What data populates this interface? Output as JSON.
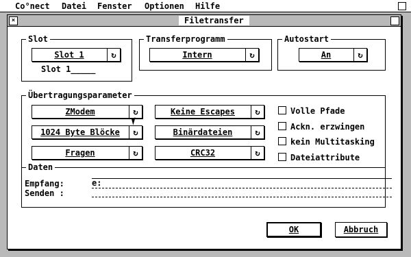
{
  "menubar": {
    "items": [
      "Co°nect",
      "Datei",
      "Fenster",
      "Optionen",
      "Hilfe"
    ]
  },
  "window": {
    "title": "Filetransfer",
    "close_glyph": "×"
  },
  "slot": {
    "legend": "Slot",
    "popup_value": "Slot 1",
    "info": "Slot 1_____"
  },
  "transfer": {
    "legend": "Transferprogramm",
    "popup_value": "Intern"
  },
  "autostart": {
    "legend": "Autostart",
    "popup_value": "An"
  },
  "params": {
    "legend": "Übertragungsparameter",
    "col1": [
      "ZModem",
      "1024 Byte Blöcke",
      "Fragen"
    ],
    "col2": [
      "Keine Escapes",
      "Binärdateien",
      "CRC32"
    ],
    "checkboxes": [
      {
        "label": "Volle Pfade",
        "checked": false
      },
      {
        "label": "Ackn. erzwingen",
        "checked": false
      },
      {
        "label": "kein Multitasking",
        "checked": false
      },
      {
        "label": "Dateiattribute",
        "checked": false
      }
    ]
  },
  "daten": {
    "legend": "Daten",
    "empfang_label": "Empfang:",
    "empfang_value": "e:",
    "senden_label": "Senden :",
    "senden_value": ""
  },
  "buttons": {
    "ok": "OK",
    "cancel": "Abbruch"
  },
  "cycle_glyph": "↻"
}
